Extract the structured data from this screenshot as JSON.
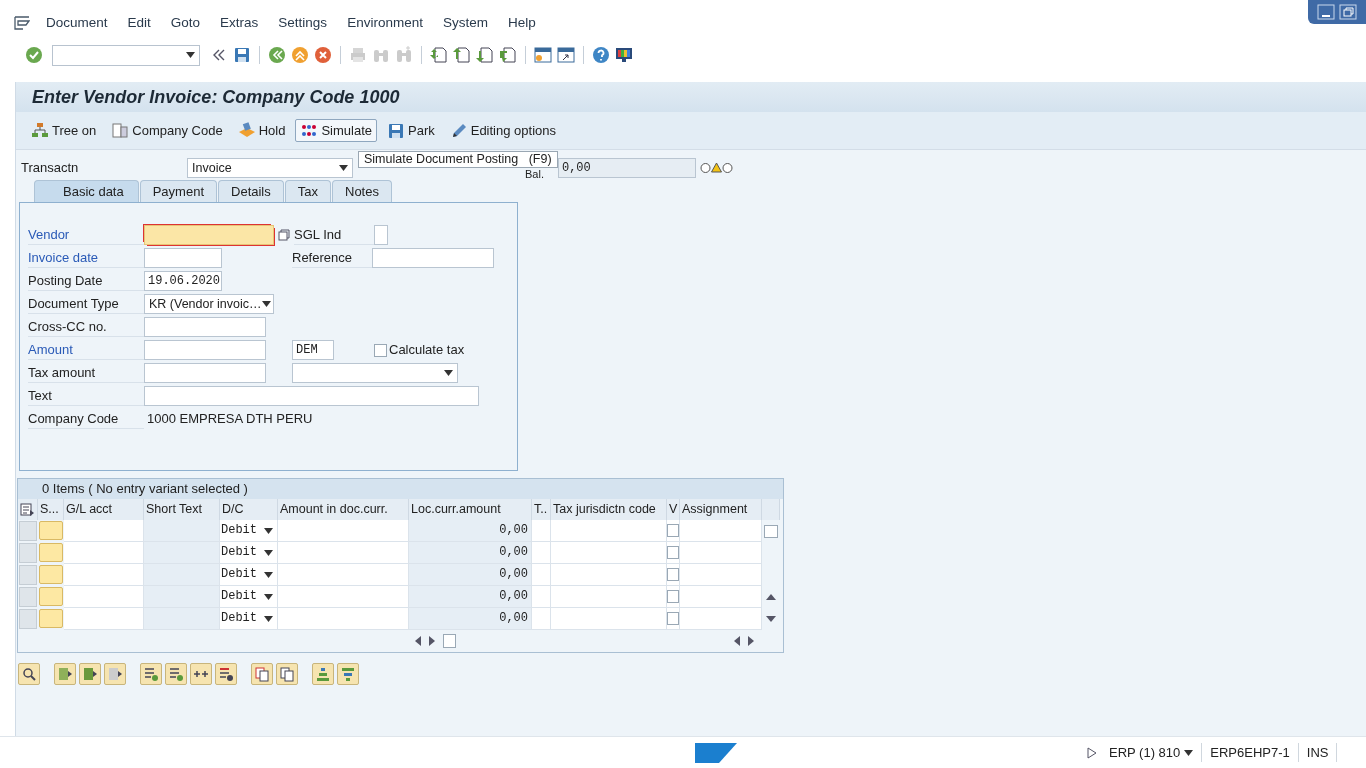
{
  "menu": [
    "Document",
    "Edit",
    "Goto",
    "Extras",
    "Settings",
    "Environment",
    "System",
    "Help"
  ],
  "toolbar_buttons": [
    {
      "kind": "enter",
      "disabled": false
    },
    {
      "kind": "command"
    },
    {
      "kind": "collapse",
      "disabled": false
    },
    {
      "kind": "save",
      "disabled": false
    },
    {
      "kind": "sep"
    },
    {
      "kind": "back",
      "disabled": false
    },
    {
      "kind": "exit",
      "disabled": false
    },
    {
      "kind": "cancel",
      "disabled": false
    },
    {
      "kind": "sep"
    },
    {
      "kind": "print",
      "disabled": true
    },
    {
      "kind": "find",
      "disabled": true
    },
    {
      "kind": "find-next",
      "disabled": true
    },
    {
      "kind": "sep"
    },
    {
      "kind": "first",
      "disabled": false
    },
    {
      "kind": "prev",
      "disabled": false
    },
    {
      "kind": "next",
      "disabled": false
    },
    {
      "kind": "last",
      "disabled": false
    },
    {
      "kind": "sep"
    },
    {
      "kind": "session",
      "disabled": false
    },
    {
      "kind": "shortcut",
      "disabled": false
    },
    {
      "kind": "sep"
    },
    {
      "kind": "help",
      "disabled": false
    },
    {
      "kind": "layout",
      "disabled": false
    }
  ],
  "title": "Enter Vendor Invoice: Company Code 1000",
  "app_buttons": [
    {
      "kind": "tree",
      "label": "Tree on",
      "hovered": false
    },
    {
      "kind": "company",
      "label": "Company Code",
      "hovered": false
    },
    {
      "kind": "hold",
      "label": "Hold",
      "hovered": false
    },
    {
      "kind": "simulate",
      "label": "Simulate",
      "hovered": true
    },
    {
      "kind": "park",
      "label": "Park",
      "hovered": false
    },
    {
      "kind": "edit",
      "label": "Editing options",
      "hovered": false
    }
  ],
  "tooltip": {
    "text": "Simulate Document Posting",
    "key": "(F9)"
  },
  "header": {
    "label": "Transactn",
    "value": "Invoice",
    "balance_label": "Bal.",
    "balance": "0,00",
    "status_lights": [
      {
        "kind": "red",
        "on": false
      },
      {
        "kind": "yellow",
        "on": true
      },
      {
        "kind": "green",
        "on": false
      }
    ]
  },
  "tabs": [
    {
      "label": "Basic data",
      "selected": true
    },
    {
      "label": "Payment",
      "selected": false
    },
    {
      "label": "Details",
      "selected": false
    },
    {
      "label": "Tax",
      "selected": false
    },
    {
      "label": "Notes",
      "selected": false
    }
  ],
  "form": [
    {
      "label": "Vendor",
      "required": true,
      "field": {
        "kind": "input",
        "focused": true,
        "help": true
      },
      "right": [
        {
          "kind": "label",
          "text": "SGL Ind"
        },
        {
          "kind": "input"
        }
      ]
    },
    {
      "label": "Invoice date",
      "required": true,
      "field": {
        "kind": "input",
        "focused": false
      },
      "right": [
        {
          "kind": "label",
          "text": "Reference"
        },
        {
          "kind": "input"
        }
      ]
    },
    {
      "label": "Posting Date",
      "required": false,
      "field": {
        "kind": "input",
        "value": "19.06.2020",
        "focused": false
      }
    },
    {
      "label": "Document Type",
      "required": false,
      "field": {
        "kind": "select",
        "value": "KR (Vendor invoic…"
      }
    },
    {
      "label": "Cross-CC no.",
      "required": false,
      "field": {
        "kind": "input",
        "focused": false
      }
    },
    {
      "label": "Amount",
      "required": true,
      "field": {
        "kind": "input",
        "focused": false
      },
      "right": [
        {
          "kind": "input",
          "value": "DEM"
        },
        {
          "kind": "checkbox",
          "text": "Calculate tax",
          "checked": false
        }
      ]
    },
    {
      "label": "Tax amount",
      "required": false,
      "field": {
        "kind": "input",
        "focused": false
      },
      "right": [
        {
          "kind": "select"
        }
      ]
    },
    {
      "label": "Text",
      "required": false,
      "field": {
        "kind": "input",
        "focused": false
      }
    },
    {
      "label": "Company Code",
      "required": false,
      "field": {
        "kind": "text",
        "value": "1000 EMPRESA DTH PERU"
      }
    }
  ],
  "items": {
    "title": "0 Items ( No entry variant selected )",
    "columns": [
      "S...",
      "G/L acct",
      "Short Text",
      "D/C",
      "Amount in doc.curr.",
      "Loc.curr.amount",
      "T..",
      "Tax jurisdictn code",
      "V",
      "Assignment"
    ],
    "rows": [
      {
        "dc": "Debit",
        "loc_amount": "0,00",
        "checked": false
      },
      {
        "dc": "Debit",
        "loc_amount": "0,00",
        "checked": false
      },
      {
        "dc": "Debit",
        "loc_amount": "0,00",
        "checked": false
      },
      {
        "dc": "Debit",
        "loc_amount": "0,00",
        "checked": false
      },
      {
        "dc": "Debit",
        "loc_amount": "0,00",
        "checked": false
      }
    ]
  },
  "status_bar": {
    "system": "ERP (1) 810",
    "server": "ERP6EHP7-1",
    "mode": "INS"
  }
}
